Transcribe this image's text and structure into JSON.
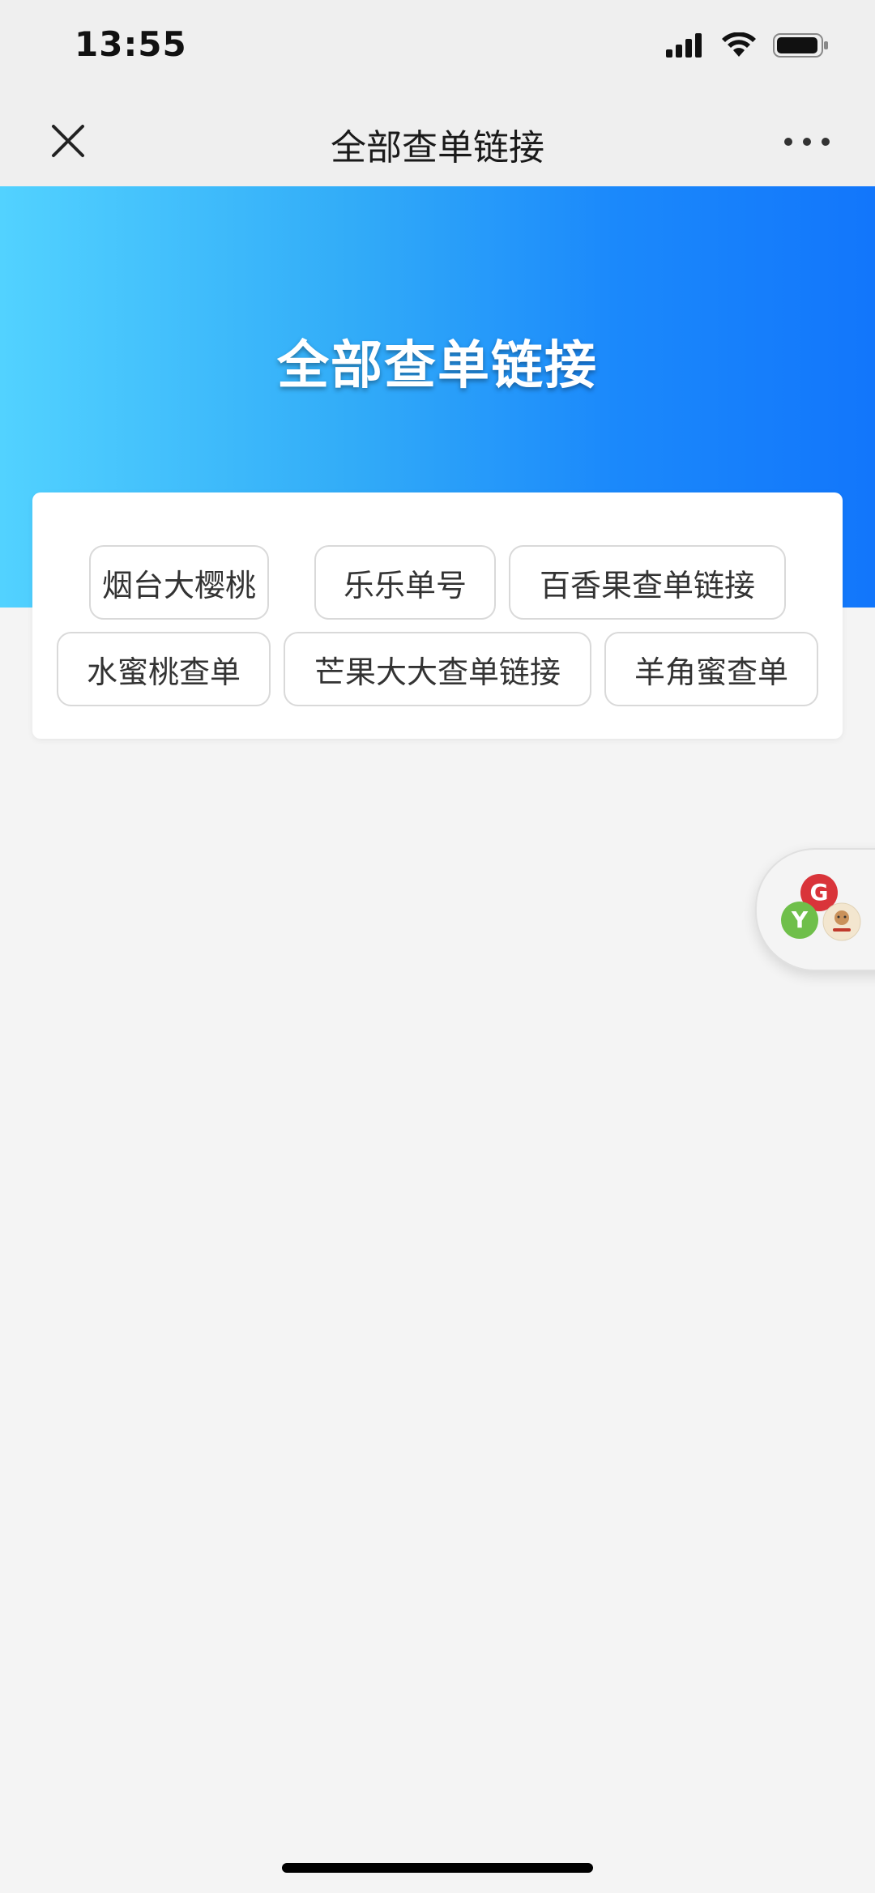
{
  "status_bar": {
    "time": "13:55"
  },
  "nav": {
    "title": "全部查单链接"
  },
  "banner": {
    "title": "全部查单链接",
    "gradient_start": "#52d2ff",
    "gradient_end": "#1276fb"
  },
  "links": [
    {
      "label": "烟台大樱桃"
    },
    {
      "label": "乐乐单号"
    },
    {
      "label": "百香果查单链接"
    },
    {
      "label": "水蜜桃查单"
    },
    {
      "label": "芒果大大查单链接"
    },
    {
      "label": "羊角蜜查单"
    }
  ],
  "float_widget": {
    "icons": [
      "red-g-app-icon",
      "green-y-app-icon",
      "cartoon-avatar-icon"
    ]
  }
}
